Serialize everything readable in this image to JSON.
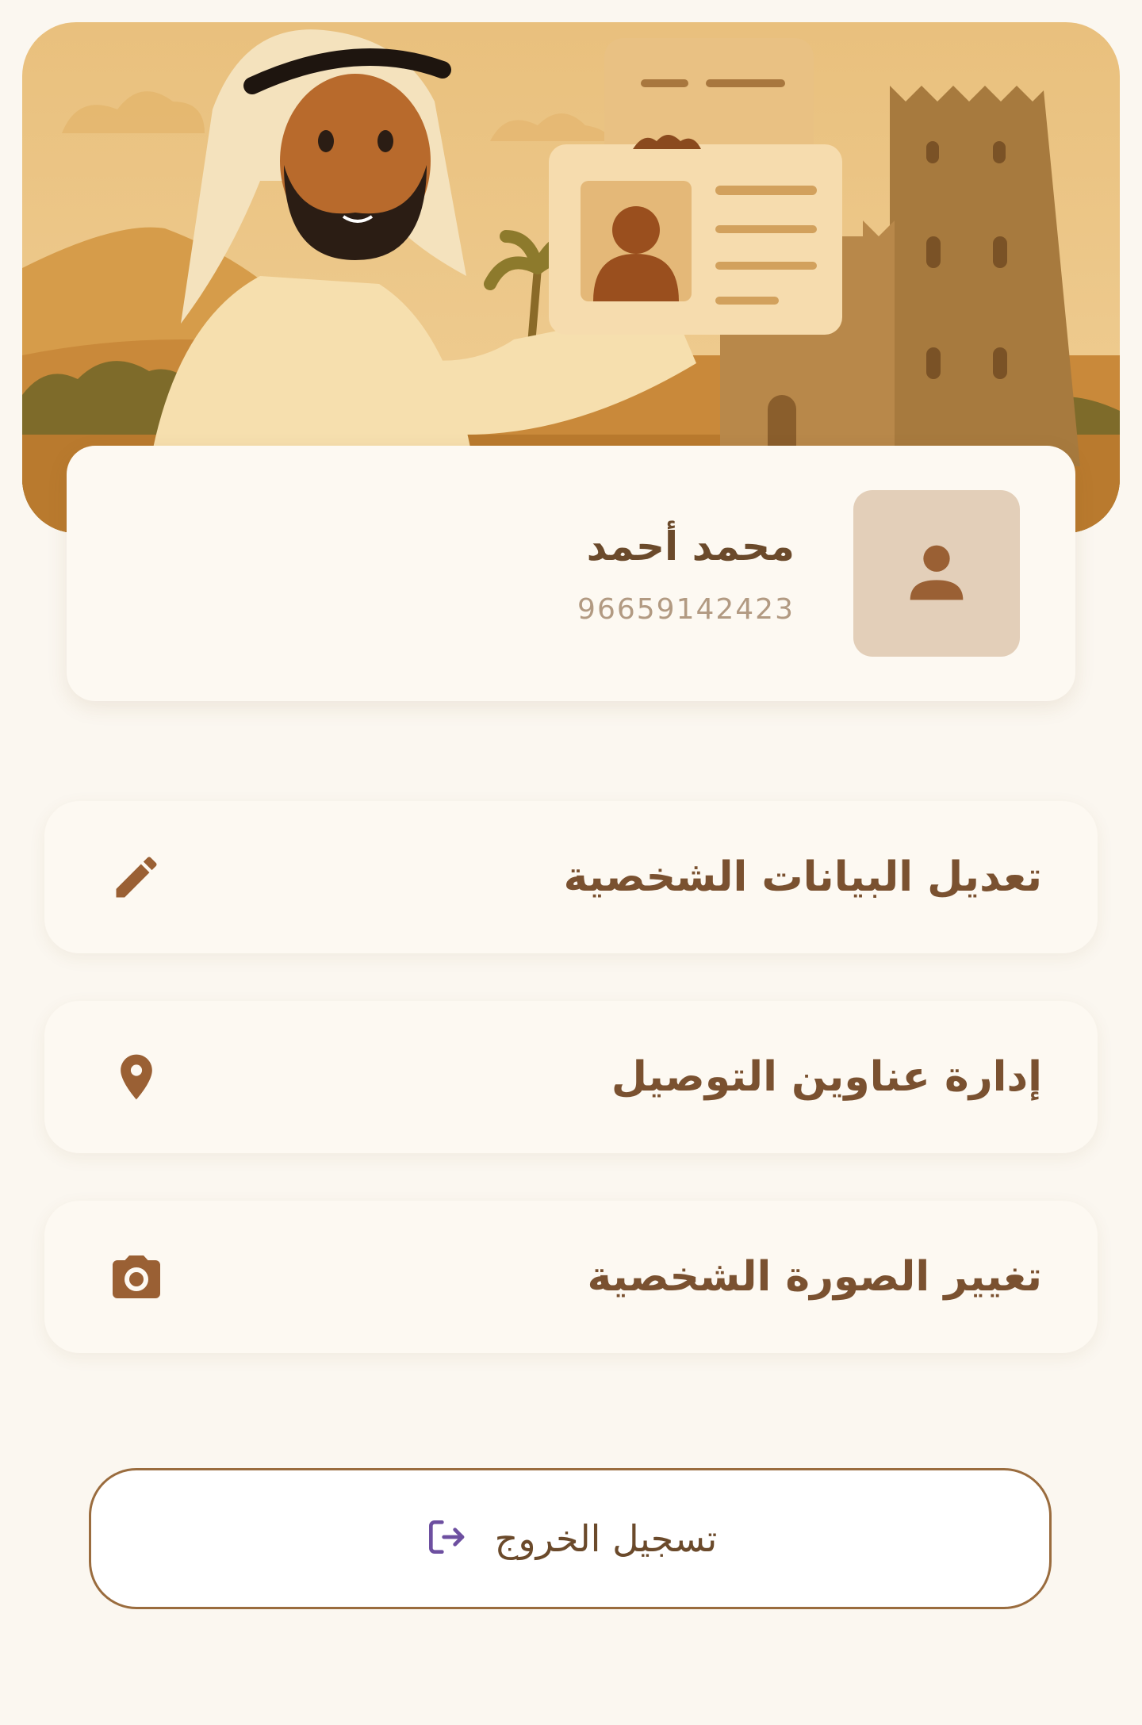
{
  "profile": {
    "name": "محمد أحمد",
    "phone": "96659142423"
  },
  "menu": {
    "items": [
      {
        "label": "تعديل البيانات الشخصية",
        "icon": "pencil-icon"
      },
      {
        "label": "إدارة عناوين التوصيل",
        "icon": "location-pin-icon"
      },
      {
        "label": "تغيير الصورة الشخصية",
        "icon": "camera-icon"
      }
    ]
  },
  "logout": {
    "label": "تسجيل الخروج",
    "icon": "logout-icon"
  },
  "colors": {
    "accent": "#9a6c3e",
    "text": "#7a5130",
    "background": "#fbf7f0",
    "logout_icon": "#6d4fa0"
  }
}
